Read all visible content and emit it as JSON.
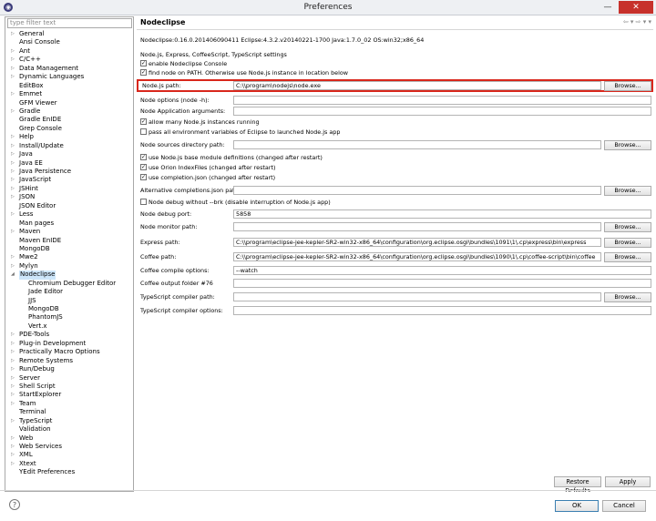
{
  "window": {
    "title": "Preferences",
    "close_glyph": "✕",
    "minimize_glyph": "—"
  },
  "filter": {
    "placeholder": "type filter text"
  },
  "tree": [
    {
      "label": "General",
      "arrow": "▷"
    },
    {
      "label": "Ansi Console",
      "arrow": ""
    },
    {
      "label": "Ant",
      "arrow": "▷"
    },
    {
      "label": "C/C++",
      "arrow": "▷"
    },
    {
      "label": "Data Management",
      "arrow": "▷"
    },
    {
      "label": "Dynamic Languages",
      "arrow": "▷"
    },
    {
      "label": "EditBox",
      "arrow": ""
    },
    {
      "label": "Emmet",
      "arrow": "▷"
    },
    {
      "label": "GFM Viewer",
      "arrow": ""
    },
    {
      "label": "Gradle",
      "arrow": "▷"
    },
    {
      "label": "Gradle EnIDE",
      "arrow": ""
    },
    {
      "label": "Grep Console",
      "arrow": ""
    },
    {
      "label": "Help",
      "arrow": "▷"
    },
    {
      "label": "Install/Update",
      "arrow": "▷"
    },
    {
      "label": "Java",
      "arrow": "▷"
    },
    {
      "label": "Java EE",
      "arrow": "▷"
    },
    {
      "label": "Java Persistence",
      "arrow": "▷"
    },
    {
      "label": "JavaScript",
      "arrow": "▷"
    },
    {
      "label": "JSHint",
      "arrow": "▷"
    },
    {
      "label": "JSON",
      "arrow": "▷"
    },
    {
      "label": "JSON Editor",
      "arrow": ""
    },
    {
      "label": "Less",
      "arrow": "▷"
    },
    {
      "label": "Man pages",
      "arrow": ""
    },
    {
      "label": "Maven",
      "arrow": "▷"
    },
    {
      "label": "Maven EnIDE",
      "arrow": ""
    },
    {
      "label": "MongoDB",
      "arrow": ""
    },
    {
      "label": "Mwe2",
      "arrow": "▷"
    },
    {
      "label": "Mylyn",
      "arrow": "▷"
    },
    {
      "label": "Nodeclipse",
      "arrow": "◢",
      "selected": true
    },
    {
      "label": "Chromium Debugger Editor",
      "arrow": "",
      "child": true
    },
    {
      "label": "Jade Editor",
      "arrow": "",
      "child": true
    },
    {
      "label": "JJS",
      "arrow": "",
      "child": true
    },
    {
      "label": "MongoDB",
      "arrow": "",
      "child": true
    },
    {
      "label": "PhantomJS",
      "arrow": "",
      "child": true
    },
    {
      "label": "Vert.x",
      "arrow": "",
      "child": true
    },
    {
      "label": "PDE-Tools",
      "arrow": "▷"
    },
    {
      "label": "Plug-in Development",
      "arrow": "▷"
    },
    {
      "label": "Practically Macro Options",
      "arrow": "▷"
    },
    {
      "label": "Remote Systems",
      "arrow": "▷"
    },
    {
      "label": "Run/Debug",
      "arrow": "▷"
    },
    {
      "label": "Server",
      "arrow": "▷"
    },
    {
      "label": "Shell Script",
      "arrow": "▷"
    },
    {
      "label": "StartExplorer",
      "arrow": "▷"
    },
    {
      "label": "Team",
      "arrow": "▷"
    },
    {
      "label": "Terminal",
      "arrow": ""
    },
    {
      "label": "TypeScript",
      "arrow": "▷"
    },
    {
      "label": "Validation",
      "arrow": ""
    },
    {
      "label": "Web",
      "arrow": "▷"
    },
    {
      "label": "Web Services",
      "arrow": "▷"
    },
    {
      "label": "XML",
      "arrow": "▷"
    },
    {
      "label": "Xtext",
      "arrow": "▷"
    },
    {
      "label": "YEdit Preferences",
      "arrow": ""
    }
  ],
  "page": {
    "title": "Nodeclipse",
    "nav_icons": "⇦ ▾ ⇨ ▾ ▾",
    "version": "Nodeclipse:0.16.0.201406090411 Eclipse:4.3.2.v20140221-1700 Java:1.7.0_02 OS:win32;x86_64",
    "settings_heading": "Node.js, Express, CoffeeScript, TypeScript settings",
    "enable_console": "enable Nodeclipse Console",
    "find_node": "find node on PATH. Otherwise use Node.js instance in location below",
    "node_path_label": "Node.js path:",
    "node_path_value": "C:\\\\program\\nodejs\\node.exe",
    "node_options_label": "Node options (node -h):",
    "node_app_args_label": "Node Application arguments:",
    "allow_many": "allow many Node.js instances running",
    "pass_env": "pass all environment variables of Eclipse to launched Node.js app",
    "node_sources_label": "Node sources directory path:",
    "use_base_module": "use Node.js base module definitions (changed after restart)",
    "use_orion": "use Orion IndexFiles (changed after restart)",
    "use_completion": "use completion.json (changed after restart)",
    "alt_completions_label": "Alternative completions.json path:",
    "debug_no_brk": "Node debug without --brk (disable interruption of Node.js app)",
    "debug_port_label": "Node debug port:",
    "debug_port_value": "5858",
    "monitor_path_label": "Node monitor path:",
    "express_path_label": "Express path:",
    "express_path_value": "C:\\\\program\\eclipse-jee-kepler-SR2-win32-x86_64\\configuration\\org.eclipse.osgi\\bundles\\1091\\1\\.cp\\express\\bin\\express",
    "coffee_path_label": "Coffee path:",
    "coffee_path_value": "C:\\\\program\\eclipse-jee-kepler-SR2-win32-x86_64\\configuration\\org.eclipse.osgi\\bundles\\1090\\1\\.cp\\coffee-script\\bin\\coffee",
    "coffee_compile_label": "Coffee compile options:",
    "coffee_compile_value": "--watch",
    "coffee_output_label": "Coffee output folder #76",
    "ts_compiler_path_label": "TypeScript compiler path:",
    "ts_compiler_options_label": "TypeScript compiler options:",
    "browse": "Browse...",
    "checked": "✓",
    "restore_defaults": "Restore Defaults",
    "apply": "Apply"
  },
  "footer": {
    "help_glyph": "?",
    "ok": "OK",
    "cancel": "Cancel"
  },
  "colors": {
    "highlight": "#d9271c",
    "selection": "#cde6fa"
  }
}
